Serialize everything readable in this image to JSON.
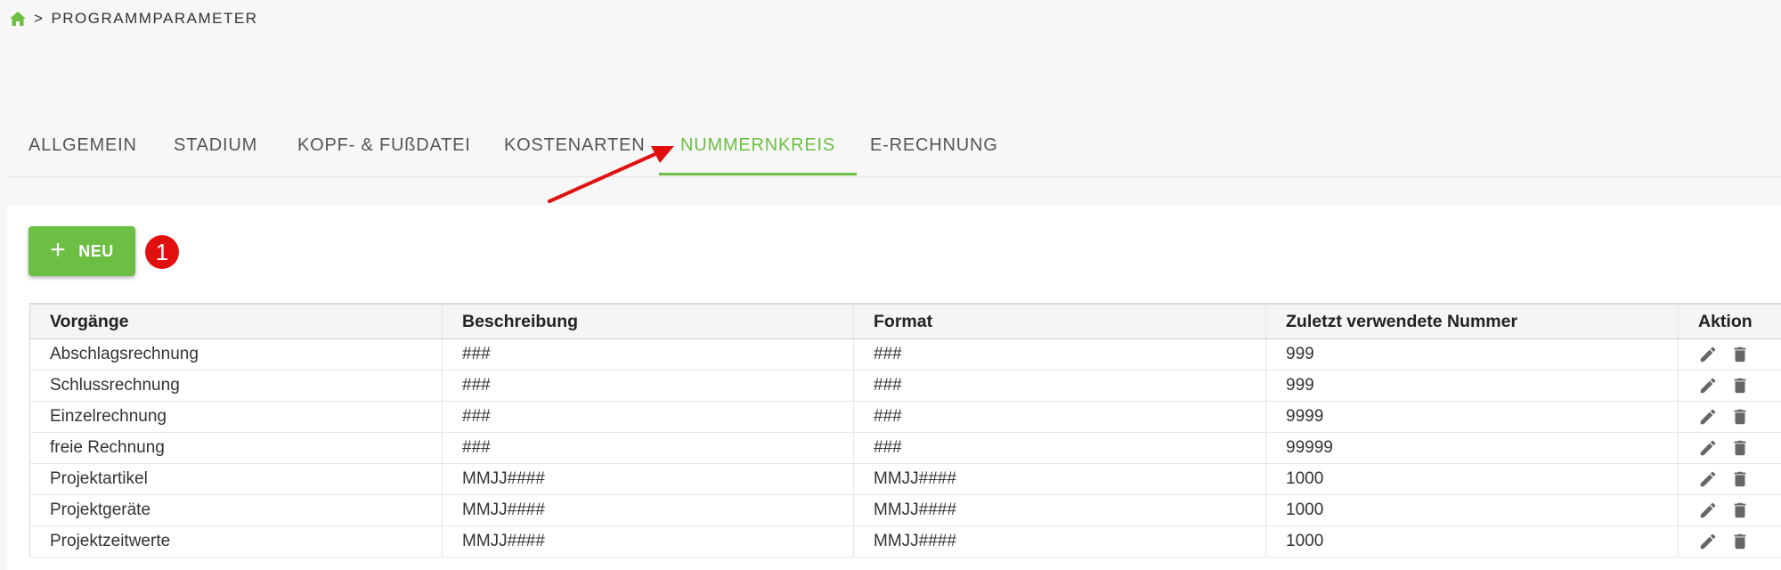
{
  "breadcrumb": {
    "home_icon": "home-icon",
    "separator": ">",
    "current": "PROGRAMMPARAMETER"
  },
  "tabs": [
    {
      "label": "ALLGEMEIN",
      "active": false
    },
    {
      "label": "STADIUM",
      "active": false
    },
    {
      "label": "KOPF- & FUßDATEI",
      "active": false
    },
    {
      "label": "KOSTENARTEN",
      "active": false
    },
    {
      "label": "NUMMERNKREIS",
      "active": true
    },
    {
      "label": "E-RECHNUNG",
      "active": false
    }
  ],
  "toolbar": {
    "new_label": "NEU",
    "new_icon": "plus-icon"
  },
  "annotation": {
    "badge": "1",
    "badge_color": "#e01010",
    "arrow_color": "#e01010"
  },
  "colors": {
    "accent": "#6cbf43"
  },
  "table": {
    "headers": [
      "Vorgänge",
      "Beschreibung",
      "Format",
      "Zuletzt verwendete Nummer",
      "Aktion"
    ],
    "rows": [
      [
        "Abschlagsrechnung",
        "###",
        "###",
        "999"
      ],
      [
        "Schlussrechnung",
        "###",
        "###",
        "999"
      ],
      [
        "Einzelrechnung",
        "###",
        "###",
        "9999"
      ],
      [
        "freie Rechnung",
        "###",
        "###",
        "99999"
      ],
      [
        "Projektartikel",
        "MMJJ####",
        "MMJJ####",
        "1000"
      ],
      [
        "Projektgeräte",
        "MMJJ####",
        "MMJJ####",
        "1000"
      ],
      [
        "Projektzeitwerte",
        "MMJJ####",
        "MMJJ####",
        "1000"
      ]
    ],
    "action_icons": [
      "pencil-icon",
      "trash-icon"
    ]
  }
}
